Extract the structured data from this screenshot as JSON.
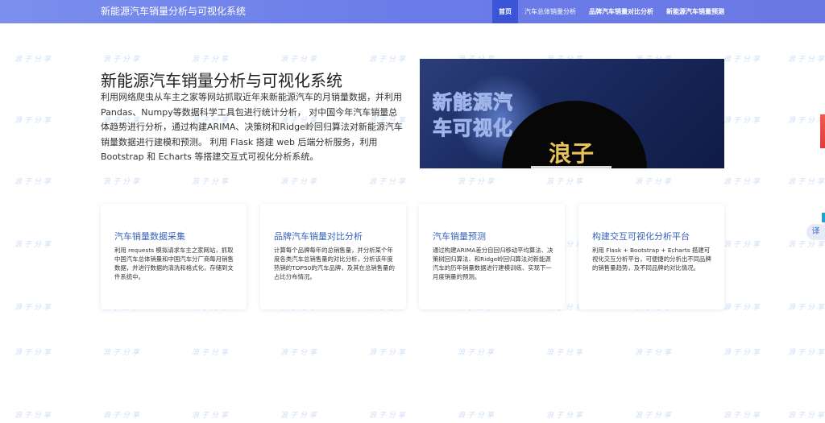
{
  "navbar": {
    "brand": "新能源汽车销量分析与可视化系统",
    "items": [
      {
        "label": "首页"
      },
      {
        "label": "汽车总体销量分析"
      },
      {
        "label": "品牌汽车销量对比分析"
      },
      {
        "label": "新能源汽车销量预测"
      }
    ]
  },
  "hero": {
    "title": "新能源汽车销量分析与可视化系统",
    "description": "利用网络爬虫从车主之家等网站抓取近年来新能源汽车的月销量数据，并利用Pandas、Numpy等数据科学工具包进行统计分析， 对中国今年汽车销量总体趋势进行分析，通过构建ARIMA、决策树和Ridge岭回归算法对新能源汽车销量数据进行建模和预测。 利用 Flask 搭建 web 后端分析服务，利用 Bootstrap 和 Echarts 等搭建交互式可视化分析系统。",
    "image_text_line1": "新能源汽",
    "image_text_line2": "车可视化",
    "image_text_logo": "浪子"
  },
  "cards": [
    {
      "title": "汽车销量数据采集",
      "text": "利用 requests 模拟请求车主之家网站，抓取中国汽车总体销量和中国汽车分厂商每月销售数据，并进行数据的清洗和格式化，存储到文件系统中。"
    },
    {
      "title": "品牌汽车销量对比分析",
      "text": "计算每个品牌每年的总销售量，并分析某个年度各类汽车总销售量的对比分析，分析该年度热销的TOP50的汽车品牌，及其在总销售量的占比分布情况。"
    },
    {
      "title": "汽车销量预测",
      "text": "通过构建ARIMA差分自回归移动平均算法、决策树回归算法、和Ridge岭回归算法对新能源汽车的历年销量数据进行建模训练、实现下一月度销量的预测。"
    },
    {
      "title": "构建交互可视化分析平台",
      "text": "利用 Flask + Bootstrap + Echarts 搭建可视化交互分析平台，可便捷的分析出不同品牌的销售量趋势，及不同品牌的对比情况。"
    }
  ],
  "watermark": {
    "text": "浪子分享"
  },
  "floating": {
    "translate_label": "译"
  },
  "colors": {
    "nav_gradient_start": "#7b8fee",
    "nav_gradient_end": "#6b78e4",
    "nav_active": "#3c54d6",
    "card_title": "#3a63b8"
  }
}
